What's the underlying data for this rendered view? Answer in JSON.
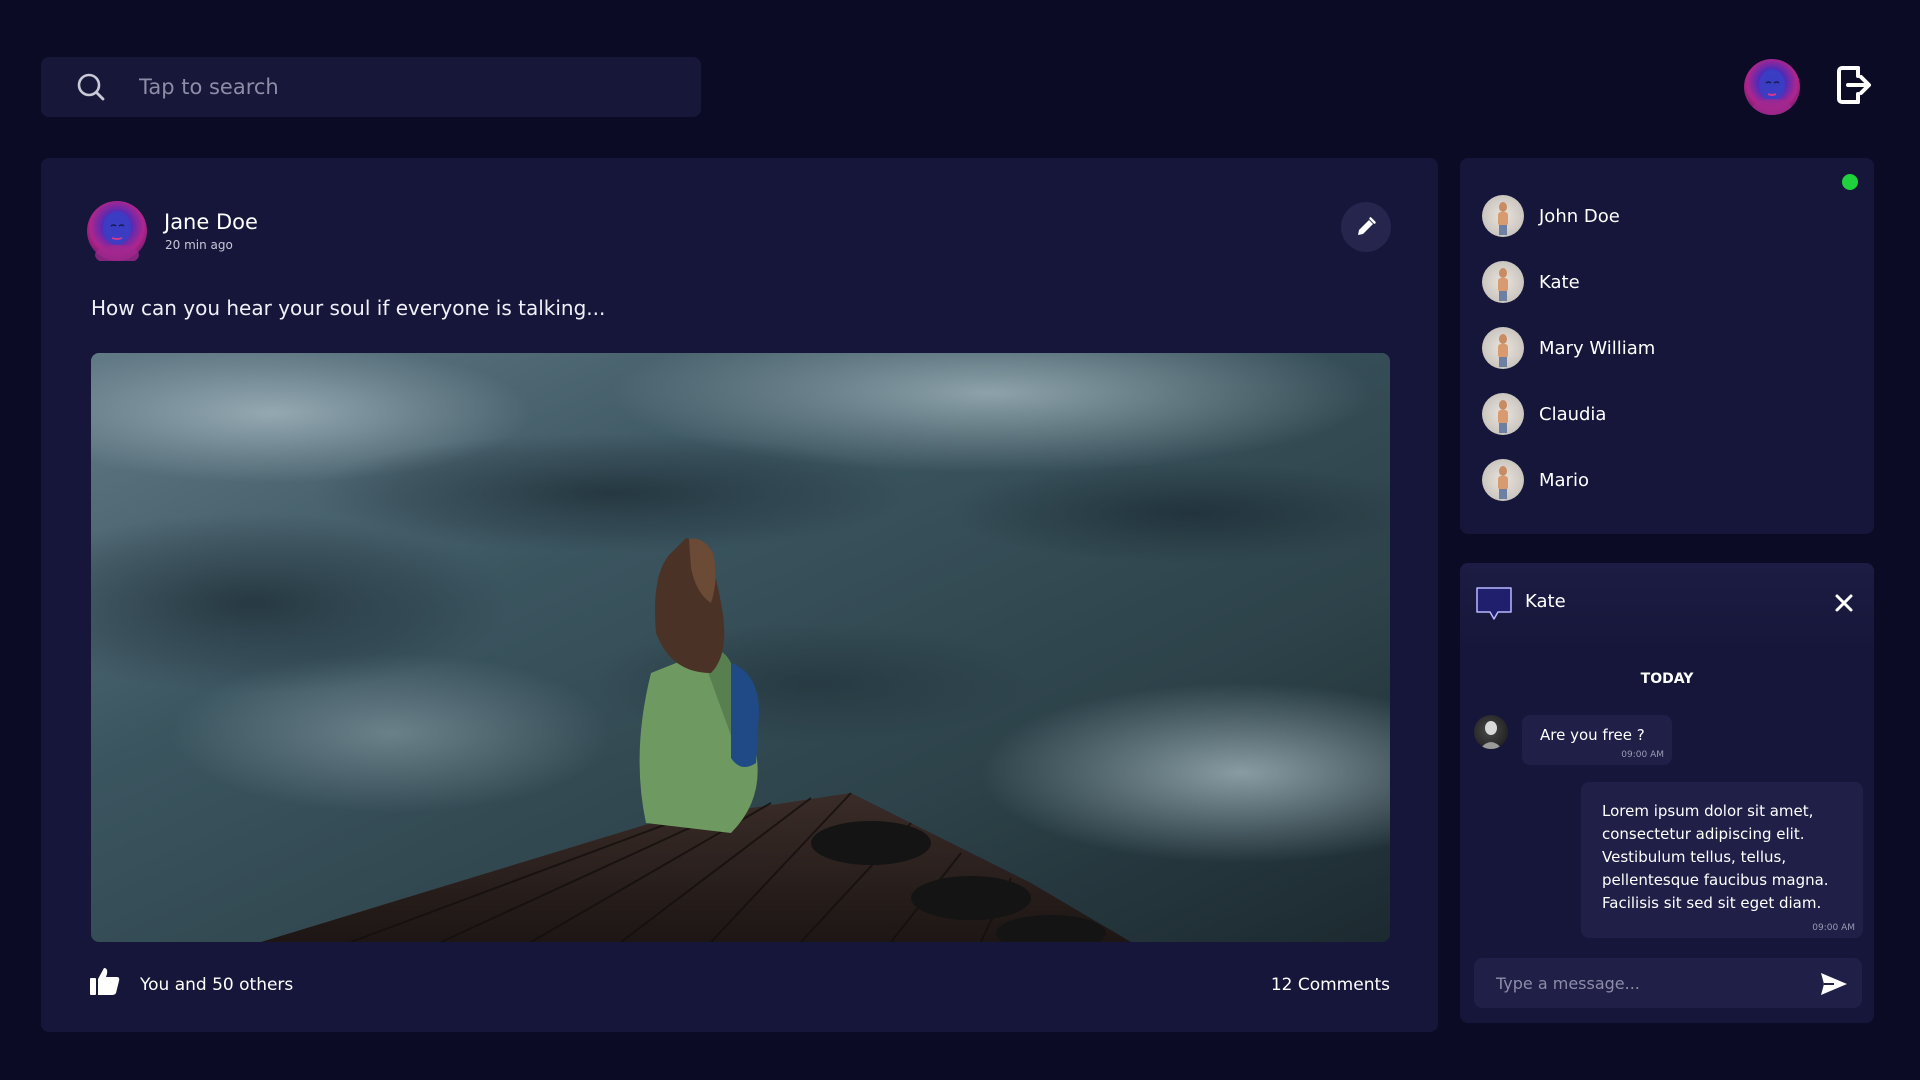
{
  "search": {
    "placeholder": "Tap to search",
    "icon": "search-icon"
  },
  "header": {
    "logout_icon": "logout-icon"
  },
  "post": {
    "author": "Jane Doe",
    "time": "20 min ago",
    "text": "How can you hear your soul if everyone is talking...",
    "likes": "You and 50 others",
    "comments": "12 Comments"
  },
  "contacts": {
    "items": [
      {
        "name": "John Doe"
      },
      {
        "name": "Kate"
      },
      {
        "name": "Mary William"
      },
      {
        "name": "Claudia"
      },
      {
        "name": "Mario"
      }
    ]
  },
  "chat": {
    "name": "Kate",
    "day": "TODAY",
    "messages": [
      {
        "text": "Are you free ?",
        "time": "09:00 AM"
      },
      {
        "text": "Lorem ipsum dolor sit amet, consectetur adipiscing elit. Vestibulum tellus, tellus, pellentesque faucibus magna. Facilisis sit sed sit eget diam.",
        "time": "09:00 AM"
      }
    ],
    "input_placeholder": "Type a message..."
  },
  "colors": {
    "background": "#0b0b26",
    "card": "#16163a",
    "bubble": "#1f1f47",
    "online": "#1fd13c"
  }
}
